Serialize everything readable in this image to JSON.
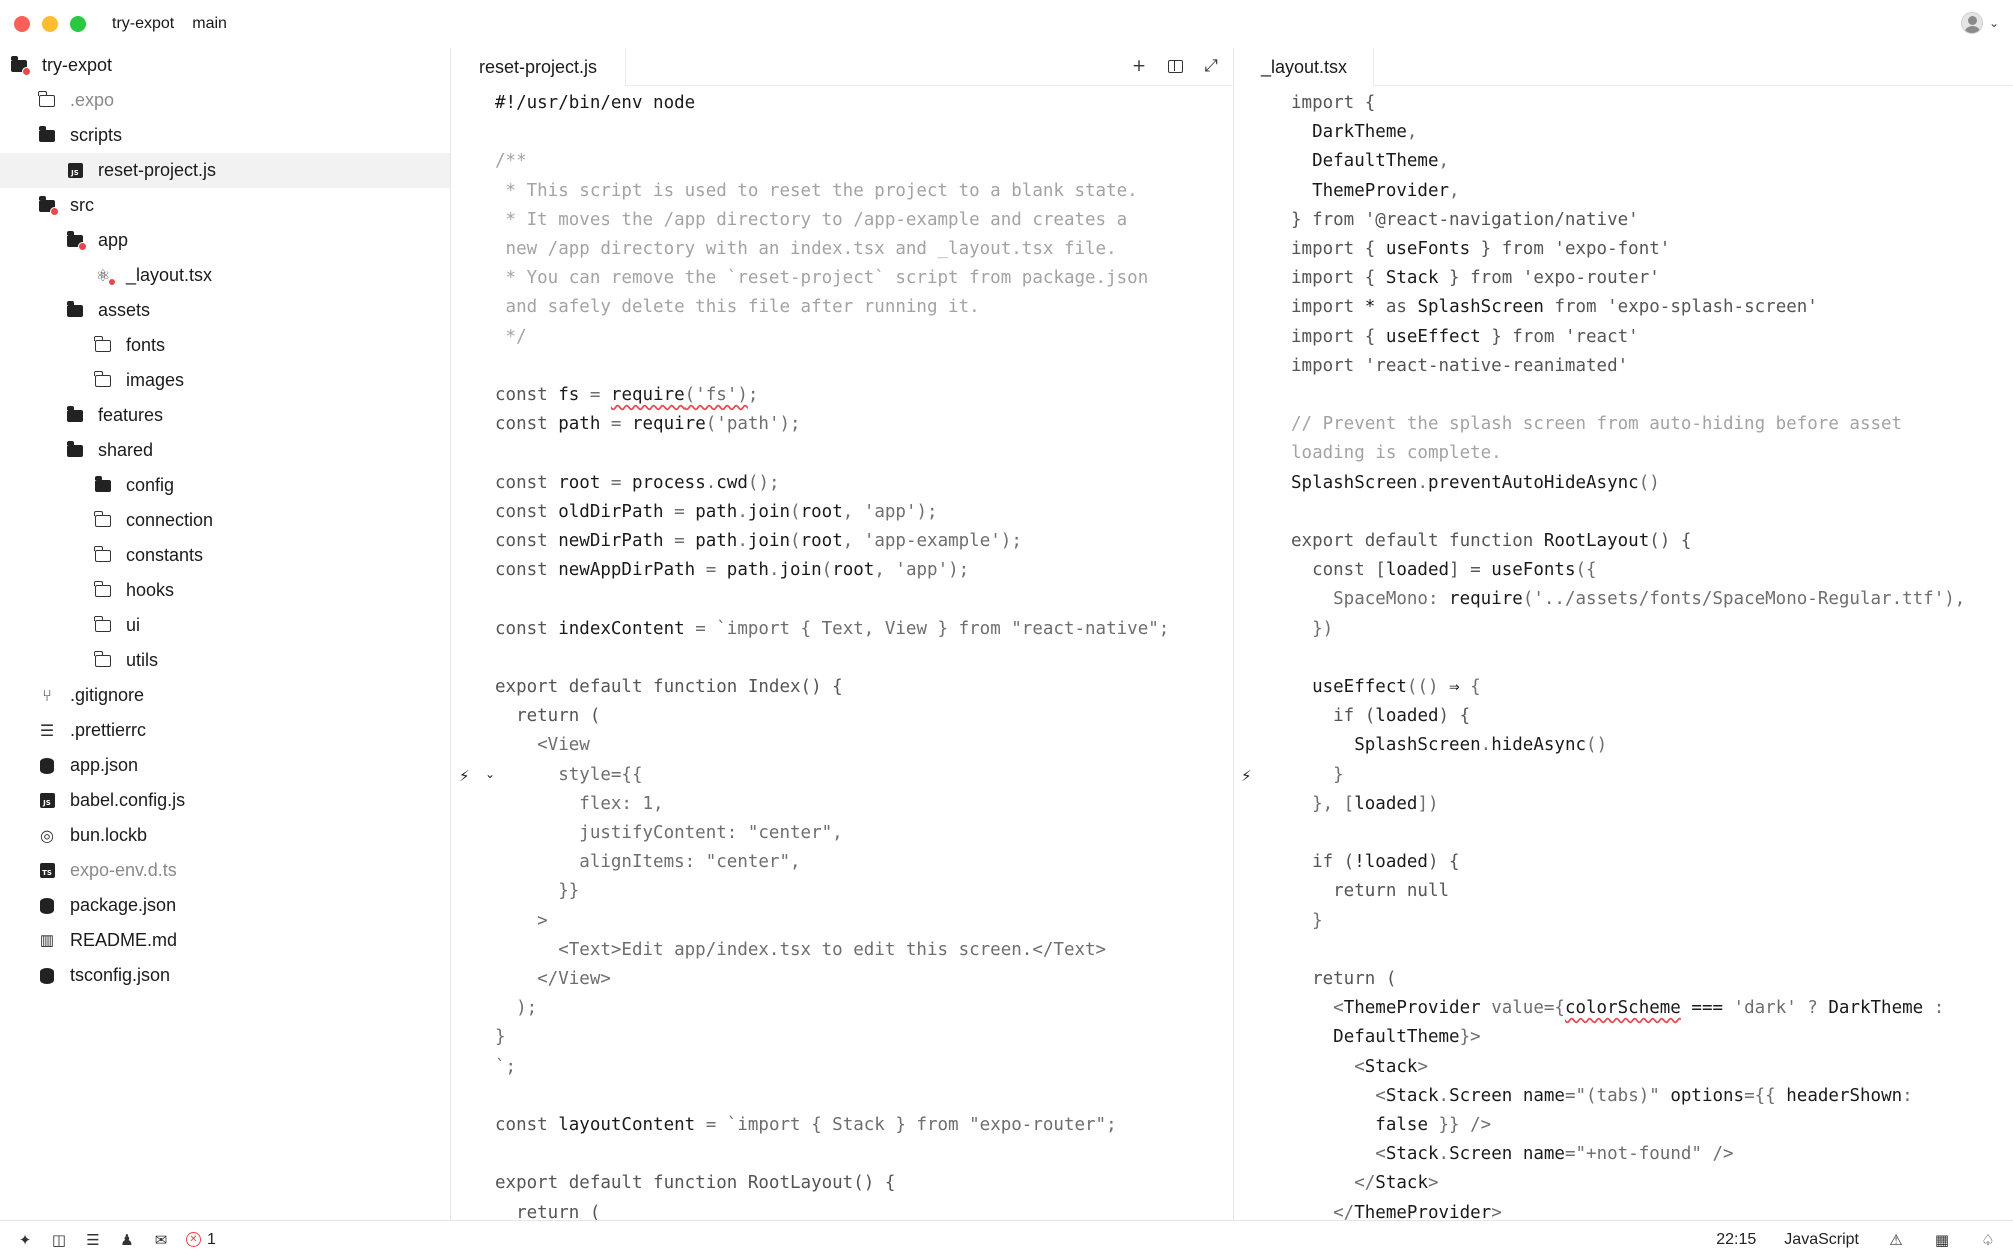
{
  "window": {
    "project": "try-expot",
    "branch": "main"
  },
  "sidebar": {
    "items": [
      {
        "label": "try-expot",
        "icon": "folder-open-badge-icon",
        "depth": 0,
        "top": 0
      },
      {
        "label": ".expo",
        "icon": "folder-icon",
        "depth": 1,
        "dim": true
      },
      {
        "label": "scripts",
        "icon": "folder-open-icon",
        "depth": 1
      },
      {
        "label": "reset-project.js",
        "icon": "js-file-icon",
        "depth": 2,
        "selected": true
      },
      {
        "label": "src",
        "icon": "folder-open-badge-icon",
        "depth": 1
      },
      {
        "label": "app",
        "icon": "folder-open-badge-icon",
        "depth": 2
      },
      {
        "label": "_layout.tsx",
        "icon": "react-file-icon",
        "depth": 3
      },
      {
        "label": "assets",
        "icon": "folder-open-icon",
        "depth": 2
      },
      {
        "label": "fonts",
        "icon": "folder-icon",
        "depth": 3
      },
      {
        "label": "images",
        "icon": "folder-icon",
        "depth": 3
      },
      {
        "label": "features",
        "icon": "folder-open-icon",
        "depth": 2
      },
      {
        "label": "shared",
        "icon": "folder-open-icon",
        "depth": 2
      },
      {
        "label": "config",
        "icon": "folder-open-icon",
        "depth": 3
      },
      {
        "label": "connection",
        "icon": "folder-icon",
        "depth": 3
      },
      {
        "label": "constants",
        "icon": "folder-icon",
        "depth": 3
      },
      {
        "label": "hooks",
        "icon": "folder-icon",
        "depth": 3
      },
      {
        "label": "ui",
        "icon": "folder-icon",
        "depth": 3
      },
      {
        "label": "utils",
        "icon": "folder-icon",
        "depth": 3
      },
      {
        "label": ".gitignore",
        "icon": "git-icon",
        "depth": 1
      },
      {
        "label": ".prettierrc",
        "icon": "settings-lines-icon",
        "depth": 1
      },
      {
        "label": "app.json",
        "icon": "json-file-icon",
        "depth": 1
      },
      {
        "label": "babel.config.js",
        "icon": "js-file-icon",
        "depth": 1
      },
      {
        "label": "bun.lockb",
        "icon": "bun-icon",
        "depth": 1
      },
      {
        "label": "expo-env.d.ts",
        "icon": "ts-file-icon",
        "depth": 1,
        "dim": true
      },
      {
        "label": "package.json",
        "icon": "json-file-icon",
        "depth": 1
      },
      {
        "label": "README.md",
        "icon": "book-icon",
        "depth": 1
      },
      {
        "label": "tsconfig.json",
        "icon": "json-file-icon",
        "depth": 1
      }
    ]
  },
  "left_pane": {
    "tab": "reset-project.js",
    "lines": [
      [
        [
          "#!/usr/bin/env node",
          "b"
        ]
      ],
      [],
      [
        [
          "/**",
          "c"
        ]
      ],
      [
        [
          " * This script is used to reset the project to a blank state.",
          "c"
        ]
      ],
      [
        [
          " * It moves the /app directory to /app-example and creates a",
          "c"
        ]
      ],
      [
        [
          " new /app directory with an index.tsx and _layout.tsx file.",
          "c"
        ]
      ],
      [
        [
          " * You can remove the `reset-project` script from package.json",
          "c"
        ]
      ],
      [
        [
          " and safely delete this file after running it.",
          "c"
        ]
      ],
      [
        [
          " */",
          "c"
        ]
      ],
      [],
      [
        [
          "const ",
          "k"
        ],
        [
          "fs",
          "b"
        ],
        [
          " = ",
          "p"
        ],
        [
          "require",
          "b",
          "squig"
        ],
        [
          "('fs')",
          "s",
          "squig"
        ],
        [
          ";",
          "p"
        ]
      ],
      [
        [
          "const ",
          "k"
        ],
        [
          "path",
          "b"
        ],
        [
          " = ",
          "p"
        ],
        [
          "require",
          "b"
        ],
        [
          "('path')",
          "s"
        ],
        [
          ";",
          "p"
        ]
      ],
      [],
      [
        [
          "const ",
          "k"
        ],
        [
          "root",
          "b"
        ],
        [
          " = ",
          "p"
        ],
        [
          "process",
          "b"
        ],
        [
          ".",
          "p"
        ],
        [
          "cwd",
          "b"
        ],
        [
          "();",
          "p"
        ]
      ],
      [
        [
          "const ",
          "k"
        ],
        [
          "oldDirPath",
          "b"
        ],
        [
          " = ",
          "p"
        ],
        [
          "path",
          "b"
        ],
        [
          ".",
          "p"
        ],
        [
          "join",
          "b"
        ],
        [
          "(",
          "p"
        ],
        [
          "root",
          "b"
        ],
        [
          ", 'app');",
          "s"
        ]
      ],
      [
        [
          "const ",
          "k"
        ],
        [
          "newDirPath",
          "b"
        ],
        [
          " = ",
          "p"
        ],
        [
          "path",
          "b"
        ],
        [
          ".",
          "p"
        ],
        [
          "join",
          "b"
        ],
        [
          "(",
          "p"
        ],
        [
          "root",
          "b"
        ],
        [
          ", 'app-example');",
          "s"
        ]
      ],
      [
        [
          "const ",
          "k"
        ],
        [
          "newAppDirPath",
          "b"
        ],
        [
          " = ",
          "p"
        ],
        [
          "path",
          "b"
        ],
        [
          ".",
          "p"
        ],
        [
          "join",
          "b"
        ],
        [
          "(",
          "p"
        ],
        [
          "root",
          "b"
        ],
        [
          ", 'app');",
          "s"
        ]
      ],
      [],
      [
        [
          "const ",
          "k"
        ],
        [
          "indexContent",
          "b"
        ],
        [
          " = `import { Text, View } from \"react-native\";",
          "s"
        ]
      ],
      [],
      [
        [
          "export default function Index() {",
          "k"
        ]
      ],
      [
        [
          "  return (",
          "k"
        ]
      ],
      [
        [
          "    <View",
          "s"
        ]
      ],
      [
        [
          "      style={{",
          "s"
        ]
      ],
      [
        [
          "        flex: 1,",
          "s"
        ]
      ],
      [
        [
          "        justifyContent: \"center\",",
          "s"
        ]
      ],
      [
        [
          "        alignItems: \"center\",",
          "s"
        ]
      ],
      [
        [
          "      }}",
          "s"
        ]
      ],
      [
        [
          "    >",
          "s"
        ]
      ],
      [
        [
          "      <Text>Edit app/index.tsx to edit this screen.</Text>",
          "s"
        ]
      ],
      [
        [
          "    </View>",
          "s"
        ]
      ],
      [
        [
          "  );",
          "s"
        ]
      ],
      [
        [
          "}",
          "s"
        ]
      ],
      [
        [
          "`;",
          "s"
        ]
      ],
      [],
      [
        [
          "const ",
          "k"
        ],
        [
          "layoutContent",
          "b"
        ],
        [
          " = `import { Stack } from \"expo-router\";",
          "s"
        ]
      ],
      [],
      [
        [
          "export default function RootLayout() {",
          "k"
        ]
      ],
      [
        [
          "  return (",
          "k"
        ]
      ]
    ]
  },
  "right_pane": {
    "tab": "_layout.tsx",
    "lines": [
      [
        [
          "import {",
          "k"
        ]
      ],
      [
        [
          "  ",
          "p"
        ],
        [
          "DarkTheme",
          "b"
        ],
        [
          ",",
          "p"
        ]
      ],
      [
        [
          "  ",
          "p"
        ],
        [
          "DefaultTheme",
          "b"
        ],
        [
          ",",
          "p"
        ]
      ],
      [
        [
          "  ",
          "p"
        ],
        [
          "ThemeProvider",
          "b"
        ],
        [
          ",",
          "p"
        ]
      ],
      [
        [
          "} from '@react-navigation/native'",
          "k"
        ]
      ],
      [
        [
          "import { ",
          "k"
        ],
        [
          "useFonts",
          "b"
        ],
        [
          " } from 'expo-font'",
          "k"
        ]
      ],
      [
        [
          "import { ",
          "k"
        ],
        [
          "Stack",
          "b"
        ],
        [
          " } from 'expo-router'",
          "k"
        ]
      ],
      [
        [
          "import ",
          "k"
        ],
        [
          "*",
          "b"
        ],
        [
          " as ",
          "k"
        ],
        [
          "SplashScreen",
          "b"
        ],
        [
          " from 'expo-splash-screen'",
          "k"
        ]
      ],
      [
        [
          "import { ",
          "k"
        ],
        [
          "useEffect",
          "b"
        ],
        [
          " } from 'react'",
          "k"
        ]
      ],
      [
        [
          "import 'react-native-reanimated'",
          "k"
        ]
      ],
      [],
      [
        [
          "// Prevent the splash screen from auto-hiding before asset",
          "c"
        ]
      ],
      [
        [
          "loading is complete.",
          "c"
        ]
      ],
      [
        [
          "SplashScreen",
          "b"
        ],
        [
          ".",
          "p"
        ],
        [
          "preventAutoHideAsync",
          "b"
        ],
        [
          "()",
          "p"
        ]
      ],
      [],
      [
        [
          "export default function ",
          "k"
        ],
        [
          "RootLayout",
          "b"
        ],
        [
          "() {",
          "k"
        ]
      ],
      [
        [
          "  const [",
          "k"
        ],
        [
          "loaded",
          "b"
        ],
        [
          "] = ",
          "k"
        ],
        [
          "useFonts",
          "b"
        ],
        [
          "({",
          "p"
        ]
      ],
      [
        [
          "    SpaceMono: ",
          "s"
        ],
        [
          "require",
          "b"
        ],
        [
          "('../assets/fonts/SpaceMono-Regular.ttf'),",
          "s"
        ]
      ],
      [
        [
          "  })",
          "p"
        ]
      ],
      [],
      [
        [
          "  ",
          "p"
        ],
        [
          "useEffect",
          "b"
        ],
        [
          "(() ",
          "p"
        ],
        [
          "⇒",
          "b"
        ],
        [
          " {",
          "p"
        ]
      ],
      [
        [
          "    if (",
          "k"
        ],
        [
          "loaded",
          "b"
        ],
        [
          ") {",
          "k"
        ]
      ],
      [
        [
          "      ",
          "p"
        ],
        [
          "SplashScreen",
          "b"
        ],
        [
          ".",
          "p"
        ],
        [
          "hideAsync",
          "b"
        ],
        [
          "()",
          "p"
        ]
      ],
      [
        [
          "    }",
          "p"
        ]
      ],
      [
        [
          "  }, [",
          "p"
        ],
        [
          "loaded",
          "b"
        ],
        [
          "])",
          "p"
        ]
      ],
      [],
      [
        [
          "  if (",
          "k"
        ],
        [
          "!loaded",
          "b"
        ],
        [
          ") {",
          "k"
        ]
      ],
      [
        [
          "    return null",
          "k"
        ]
      ],
      [
        [
          "  }",
          "p"
        ]
      ],
      [],
      [
        [
          "  return (",
          "k"
        ]
      ],
      [
        [
          "    <",
          "s"
        ],
        [
          "ThemeProvider",
          "b"
        ],
        [
          " value={",
          "s"
        ],
        [
          "colorScheme",
          "b",
          "squig"
        ],
        [
          " ",
          "s"
        ],
        [
          "===",
          "b"
        ],
        [
          " 'dark' ? ",
          "s"
        ],
        [
          "DarkTheme",
          "b"
        ],
        [
          " :",
          "s"
        ]
      ],
      [
        [
          "    ",
          "p"
        ],
        [
          "DefaultTheme",
          "b"
        ],
        [
          "}>",
          "s"
        ]
      ],
      [
        [
          "      <",
          "s"
        ],
        [
          "Stack",
          "b"
        ],
        [
          ">",
          "s"
        ]
      ],
      [
        [
          "        <",
          "s"
        ],
        [
          "Stack",
          "b"
        ],
        [
          ".",
          "p"
        ],
        [
          "Screen",
          "b"
        ],
        [
          " ",
          "p"
        ],
        [
          "name",
          "b"
        ],
        [
          "=\"(tabs)\" ",
          "s"
        ],
        [
          "options",
          "b"
        ],
        [
          "={{ ",
          "s"
        ],
        [
          "headerShown",
          "b"
        ],
        [
          ":",
          "s"
        ]
      ],
      [
        [
          "        ",
          "p"
        ],
        [
          "false",
          "b"
        ],
        [
          " }} />",
          "s"
        ]
      ],
      [
        [
          "        <",
          "s"
        ],
        [
          "Stack",
          "b"
        ],
        [
          ".",
          "p"
        ],
        [
          "Screen",
          "b"
        ],
        [
          " ",
          "p"
        ],
        [
          "name",
          "b"
        ],
        [
          "=\"+not-found\" />",
          "s"
        ]
      ],
      [
        [
          "      </",
          "s"
        ],
        [
          "Stack",
          "b"
        ],
        [
          ">",
          "s"
        ]
      ],
      [
        [
          "    </",
          "s"
        ],
        [
          "ThemeProvider",
          "b"
        ],
        [
          ">",
          "s"
        ]
      ]
    ]
  },
  "statusbar": {
    "icons": [
      "sparkle-icon",
      "panels-icon",
      "outline-icon",
      "people-icon",
      "chat-icon"
    ],
    "errors": "1",
    "cursor": "22:15",
    "language": "JavaScript"
  }
}
